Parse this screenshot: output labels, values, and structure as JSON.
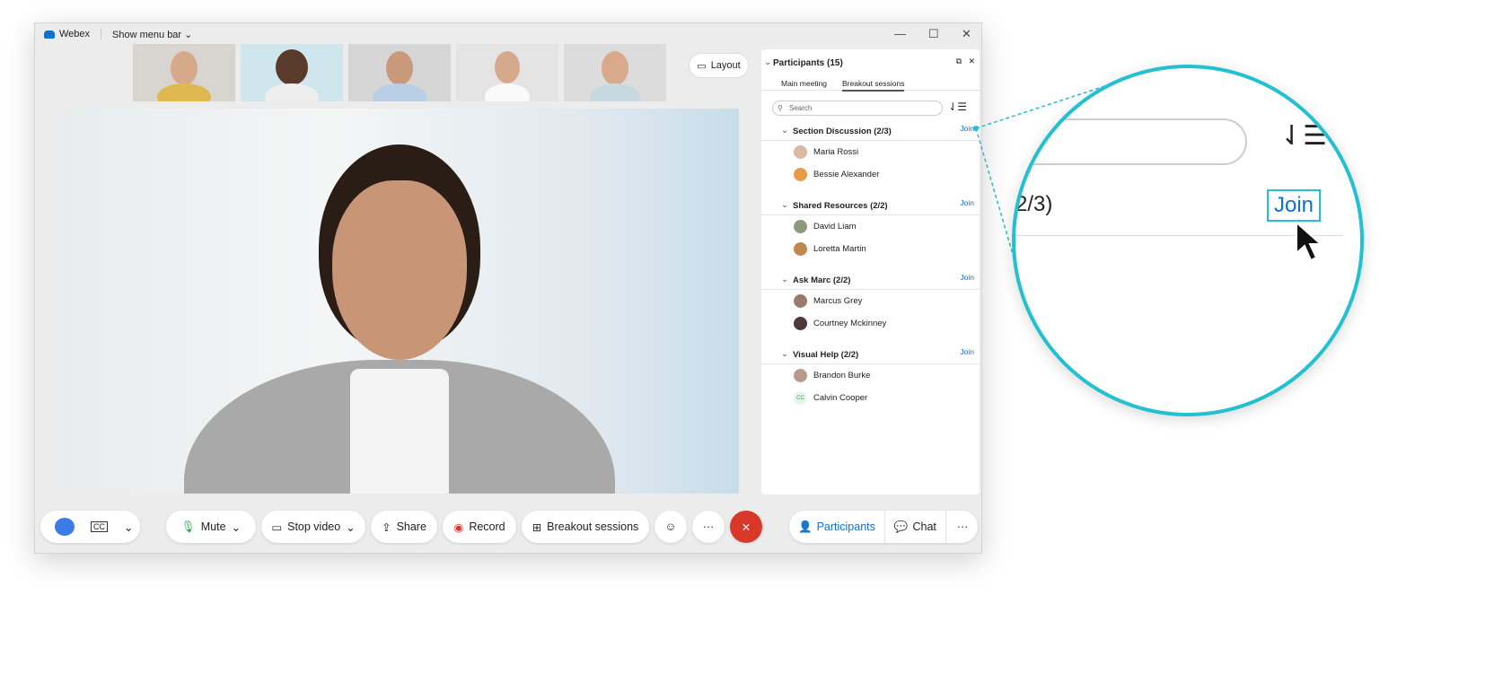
{
  "app": {
    "title": "Webex",
    "menu": "Show menu bar"
  },
  "layout_label": "Layout",
  "panel": {
    "title": "Participants (15)",
    "tabs": [
      "Main meeting",
      "Breakout sessions"
    ],
    "active_tab": "Breakout sessions",
    "search_placeholder": "Search",
    "groups": [
      {
        "name": "Section Discussion (2/3)",
        "join": "Join",
        "members": [
          "Maria Rossi",
          "Bessie Alexander"
        ]
      },
      {
        "name": "Shared Resources (2/2)",
        "join": "Join",
        "members": [
          "David Liam",
          "Loretta Martin"
        ]
      },
      {
        "name": "Ask Marc (2/2)",
        "join": "Join",
        "members": [
          "Marcus Grey",
          "Courtney Mckinney"
        ]
      },
      {
        "name": "Visual Help (2/2)",
        "join": "Join",
        "members": [
          "Brandon Burke",
          "Calvin Cooper"
        ]
      }
    ],
    "initials": "CC"
  },
  "toolbar": {
    "mute": "Mute",
    "stop_video": "Stop video",
    "share": "Share",
    "record": "Record",
    "breakout": "Breakout sessions",
    "participants": "Participants",
    "chat": "Chat"
  },
  "magnifier": {
    "fragment": "2/3)",
    "join": "Join"
  },
  "colors": {
    "accent": "#1170cf",
    "end_call": "#d93829",
    "magnifier": "#22c0d0",
    "mic": "#2fa84f"
  }
}
